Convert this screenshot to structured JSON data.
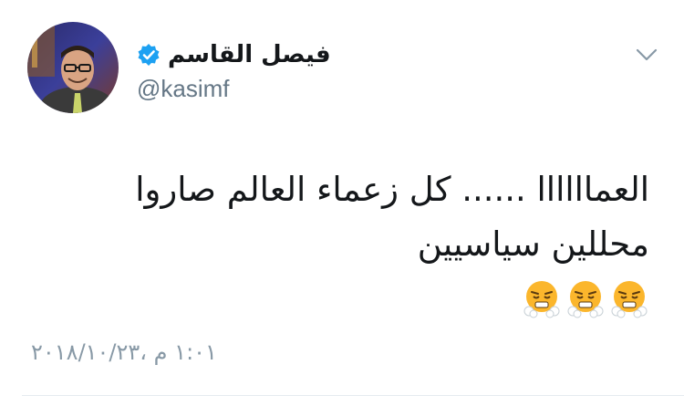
{
  "user": {
    "display_name": "فيصل القاسم",
    "handle": "@kasimf",
    "verified": true
  },
  "tweet": {
    "text": "العماااااا ...... كل زعماء العالم صاروا محللين سياسيين",
    "emojis": [
      "face-with-steam-icon",
      "face-with-steam-icon",
      "face-with-steam-icon"
    ],
    "timestamp": "١:٠١ م ،٢٠١٨/١٠/٢٣"
  },
  "icons": {
    "menu": "chevron-down-icon",
    "verified": "verified-badge-icon"
  },
  "colors": {
    "verified_blue": "#1da1f2",
    "handle_gray": "#657786",
    "timestamp_gray": "#8899a6"
  }
}
